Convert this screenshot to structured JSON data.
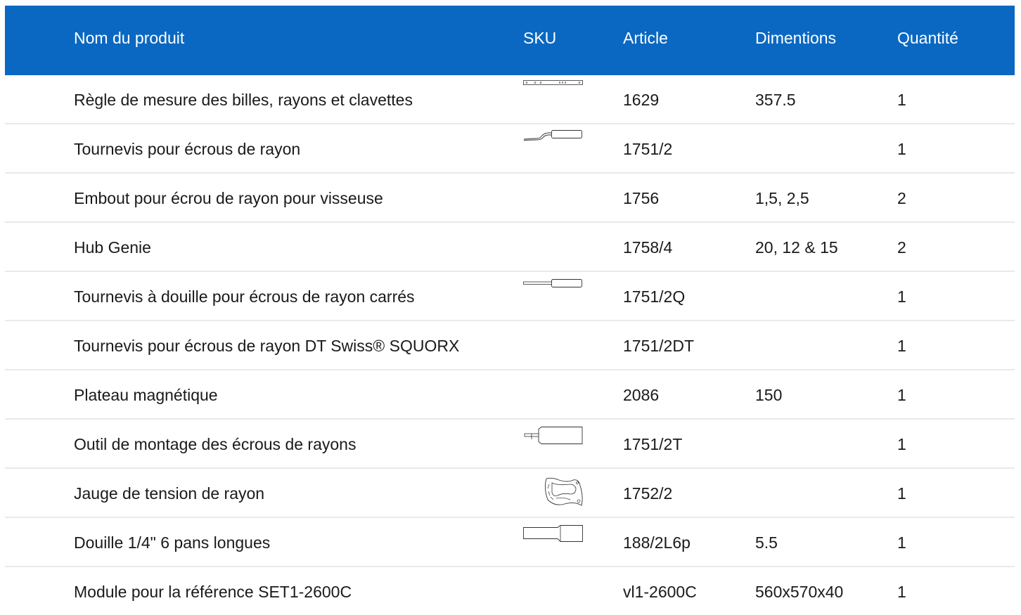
{
  "header": {
    "name": "Nom du produit",
    "sku": "SKU",
    "article": "Article",
    "dimensions": "Dimentions",
    "quantity": "Quantité"
  },
  "accent_color": "#0a68c2",
  "rows": [
    {
      "name": "Règle de mesure des billes, rayons et clavettes",
      "sku_icon": "ruler-icon",
      "article": "1629",
      "dimensions": "357.5",
      "quantity": "1"
    },
    {
      "name": "Tournevis pour écrous de rayon",
      "sku_icon": "curved-screwdriver-icon",
      "article": "1751/2",
      "dimensions": "",
      "quantity": "1"
    },
    {
      "name": "Embout pour écrou de rayon pour visseuse",
      "sku_icon": "",
      "article": "1756",
      "dimensions": "1,5, 2,5",
      "quantity": "2"
    },
    {
      "name": "Hub Genie",
      "sku_icon": "",
      "article": "1758/4",
      "dimensions": "20, 12 & 15",
      "quantity": "2"
    },
    {
      "name": "Tournevis à douille pour écrous de rayon carrés",
      "sku_icon": "socket-screwdriver-icon",
      "article": "1751/2Q",
      "dimensions": "",
      "quantity": "1"
    },
    {
      "name": "Tournevis pour écrous de rayon DT Swiss® SQUORX",
      "sku_icon": "",
      "article": "1751/2DT",
      "dimensions": "",
      "quantity": "1"
    },
    {
      "name": "Plateau magnétique",
      "sku_icon": "",
      "article": "2086",
      "dimensions": "150",
      "quantity": "1"
    },
    {
      "name": "Outil de montage des écrous de rayons",
      "sku_icon": "nipple-tool-icon",
      "article": "1751/2T",
      "dimensions": "",
      "quantity": "1"
    },
    {
      "name": "Jauge de tension de rayon",
      "sku_icon": "tension-gauge-icon",
      "article": "1752/2",
      "dimensions": "",
      "quantity": "1"
    },
    {
      "name": "Douille 1/4\" 6 pans longues",
      "sku_icon": "socket-icon",
      "article": "188/2L6p",
      "dimensions": "5.5",
      "quantity": "1"
    },
    {
      "name": "Module pour la référence SET1-2600C",
      "sku_icon": "",
      "article": "vl1-2600C",
      "dimensions": "560x570x40",
      "quantity": "1"
    }
  ]
}
